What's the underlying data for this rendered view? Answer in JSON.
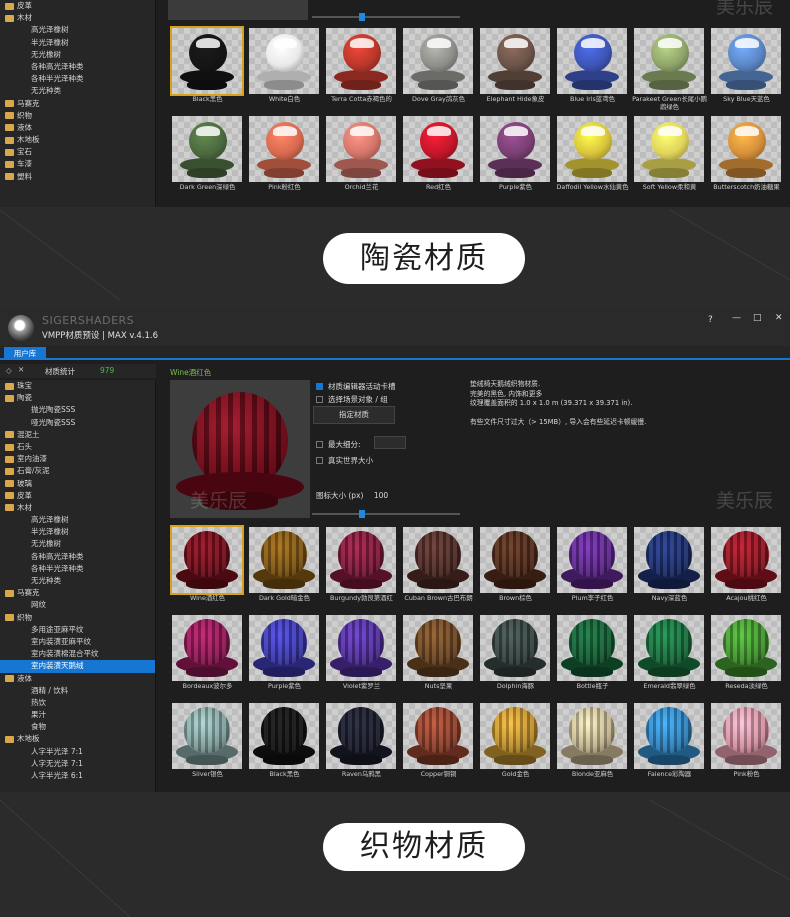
{
  "section1": {
    "tree": [
      {
        "label": "皮革",
        "level": 0,
        "folder": true
      },
      {
        "label": "木材",
        "level": 0,
        "folder": true
      },
      {
        "label": "高光泽橡树",
        "level": 1
      },
      {
        "label": "半光泽橡树",
        "level": 1
      },
      {
        "label": "无光橡树",
        "level": 1
      },
      {
        "label": "各种高光泽种类",
        "level": 1
      },
      {
        "label": "各种半光泽种类",
        "level": 1
      },
      {
        "label": "无光种类",
        "level": 1
      },
      {
        "label": "马赛克",
        "level": 0,
        "folder": true
      },
      {
        "label": "织物",
        "level": 0,
        "folder": true
      },
      {
        "label": "液体",
        "level": 0,
        "folder": true
      },
      {
        "label": "木地板",
        "level": 0,
        "folder": true
      },
      {
        "label": "宝石",
        "level": 0,
        "folder": true
      },
      {
        "label": "车漆",
        "level": 0,
        "folder": true
      },
      {
        "label": "塑料",
        "level": 0,
        "folder": true
      }
    ],
    "watermark": "美乐辰",
    "materials": [
      {
        "label": "Black黑色",
        "color": "#151515",
        "selected": true
      },
      {
        "label": "White白色",
        "color": "#e9e9e9"
      },
      {
        "label": "Terra Cotta赤褐色的",
        "color": "#b9372b"
      },
      {
        "label": "Dove Gray鸽灰色",
        "color": "#8e8e8a"
      },
      {
        "label": "Elephant Hide象皮",
        "color": "#6c5448"
      },
      {
        "label": "Blue Iris蓝鸢色",
        "color": "#3d55b6"
      },
      {
        "label": "Parakeet Green长尾小鹦鹉绿色",
        "color": "#8fa46a"
      },
      {
        "label": "Sky Blue天蓝色",
        "color": "#5b86c4"
      },
      {
        "label": "Dark Green深绿色",
        "color": "#4b6a3f"
      },
      {
        "label": "Pink粉红色",
        "color": "#d7694f"
      },
      {
        "label": "Orchid兰花",
        "color": "#d4756a"
      },
      {
        "label": "Red红色",
        "color": "#c3172a"
      },
      {
        "label": "Purple紫色",
        "color": "#7a3f74"
      },
      {
        "label": "Daffodil Yellow水仙黄色",
        "color": "#d8c43c"
      },
      {
        "label": "Soft Yellow柔和黄",
        "color": "#e0d45a"
      },
      {
        "label": "Butterscotch奶油糖果",
        "color": "#d7903a"
      }
    ]
  },
  "pill1": "陶瓷材质",
  "section2": {
    "brand": "SIGERSHADERS",
    "title": "VMPP材质预设 | MAX v.4.1.6",
    "window_controls": [
      "?",
      "—",
      "□",
      "✕"
    ],
    "tab": "用户库",
    "stats_label": "材质统计",
    "stats_count": "979",
    "preview_title": "Wine酒红色",
    "options": {
      "editor_active": "材质编辑器活动卡槽",
      "select_scene": "选择场景对象 / 组",
      "assign_button": "指定材质",
      "max_subdiv": "最大细分:",
      "real_world": "真实世界大小",
      "size_label": "图标大小 (px)",
      "size_value": "100"
    },
    "description": [
      "垫绒椅天鹅绒织物材质.",
      "完美的黑色, 内饰和更多",
      "纹理覆盖面积的 1.0 x 1.0 m (39.371 x 39.371 in).",
      "",
      "有些文件尺寸过大（> 15MB）, 导入会有些延迟卡顿缓慢."
    ],
    "tree": [
      {
        "label": "珠宝",
        "level": 0,
        "folder": true
      },
      {
        "label": "陶瓷",
        "level": 0,
        "folder": true
      },
      {
        "label": "抛光陶瓷SSS",
        "level": 1
      },
      {
        "label": "哑光陶瓷SSS",
        "level": 1
      },
      {
        "label": "混泥土",
        "level": 0,
        "folder": true
      },
      {
        "label": "石头",
        "level": 0,
        "folder": true
      },
      {
        "label": "室内油漆",
        "level": 0,
        "folder": true
      },
      {
        "label": "石膏/灰泥",
        "level": 0,
        "folder": true
      },
      {
        "label": "玻璃",
        "level": 0,
        "folder": true
      },
      {
        "label": "皮革",
        "level": 0,
        "folder": true
      },
      {
        "label": "木材",
        "level": 0,
        "folder": true
      },
      {
        "label": "高光泽橡树",
        "level": 1
      },
      {
        "label": "半光泽橡树",
        "level": 1
      },
      {
        "label": "无光橡树",
        "level": 1
      },
      {
        "label": "各种高光泽种类",
        "level": 1
      },
      {
        "label": "各种半光泽种类",
        "level": 1
      },
      {
        "label": "无光种类",
        "level": 1
      },
      {
        "label": "马赛克",
        "level": 0,
        "folder": true
      },
      {
        "label": "网纹",
        "level": 1
      },
      {
        "label": "织物",
        "level": 0,
        "folder": true
      },
      {
        "label": "多用途亚麻平纹",
        "level": 1
      },
      {
        "label": "室内装潢亚麻平纹",
        "level": 1
      },
      {
        "label": "室内装潢棉混合平纹",
        "level": 1
      },
      {
        "label": "室内装潢天鹅绒",
        "level": 1,
        "selected": true
      },
      {
        "label": "液体",
        "level": 0,
        "folder": true
      },
      {
        "label": "酒精 / 饮料",
        "level": 1
      },
      {
        "label": "热饮",
        "level": 1
      },
      {
        "label": "果汁",
        "level": 1
      },
      {
        "label": "食物",
        "level": 1
      },
      {
        "label": "木地板",
        "level": 0,
        "folder": true
      },
      {
        "label": "人字半光泽 7:1",
        "level": 1
      },
      {
        "label": "人字无光泽 7:1",
        "level": 1
      },
      {
        "label": "人字半光泽 6:1",
        "level": 1
      }
    ],
    "watermark": "美乐辰",
    "materials": [
      {
        "label": "Wine酒红色",
        "color": "#6e0d1a",
        "selected": true
      },
      {
        "label": "Dark Gold暗金色",
        "color": "#7a5212"
      },
      {
        "label": "Burgundy勃艮第酒红",
        "color": "#7a1838"
      },
      {
        "label": "Cuban Brown古巴布朗",
        "color": "#4d2a25"
      },
      {
        "label": "Brown棕色",
        "color": "#4e2a1a"
      },
      {
        "label": "Plum李子红色",
        "color": "#5a2588"
      },
      {
        "label": "Navy深蓝色",
        "color": "#1c2d6a"
      },
      {
        "label": "Acajou桃红色",
        "color": "#8a1320"
      },
      {
        "label": "Bordeaux波尔多",
        "color": "#8c1752"
      },
      {
        "label": "Purple紫色",
        "color": "#3a36a8"
      },
      {
        "label": "Violet紫罗兰",
        "color": "#4e2d96"
      },
      {
        "label": "Nuts坚果",
        "color": "#6a4421"
      },
      {
        "label": "Dolphin海豚",
        "color": "#34413f"
      },
      {
        "label": "Bottle瓶子",
        "color": "#135a32"
      },
      {
        "label": "Emerald翡翠绿色",
        "color": "#176b3a"
      },
      {
        "label": "Reseda淡绿色",
        "color": "#3f8f2c"
      },
      {
        "label": "Silver银色",
        "color": "#7c9a98"
      },
      {
        "label": "Black黑色",
        "color": "#121212"
      },
      {
        "label": "Raven乌鸦黑",
        "color": "#1a1c2a"
      },
      {
        "label": "Copper铜铜",
        "color": "#8a3e2a"
      },
      {
        "label": "Gold金色",
        "color": "#b88a2c"
      },
      {
        "label": "Blonde亚麻色",
        "color": "#bfb08c"
      },
      {
        "label": "Faience彩陶器",
        "color": "#2e7fb9"
      },
      {
        "label": "Pink粉色",
        "color": "#d08c9c"
      }
    ]
  },
  "pill2": "织物材质"
}
